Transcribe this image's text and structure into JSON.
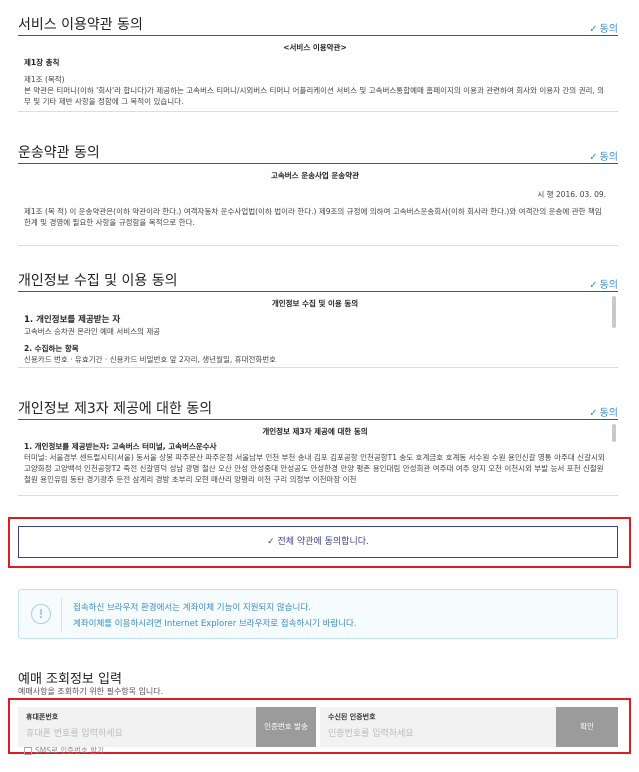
{
  "agree_label": "동의",
  "sections": [
    {
      "title": "서비스 이용약관 동의",
      "doc_title": "<서비스 이용약관>",
      "chapter": "제1장 총칙",
      "article": "제1조 (목적)",
      "body": "본 약관은 티머니(이하 '회사'라 합니다)가 제공하는 고속버스 티머니/시외버스 티머니 어플리케이션 서비스 및 고속버스통합예매 홈페이지의 이용과 관련하여 회사와 이용자 간의 권리, 의무 및 기타 제반 사항을 정함에 그 목적이 있습니다."
    },
    {
      "title": "운송약관 동의",
      "doc_title": "고속버스 운송사업 운송약관",
      "date": "시 행 2016. 03. 09.",
      "body": "제1조 (목 적) 이 운송약관은(이하 약관이라 한다.) 여객자동차 운수사업법(이하 법이라 한다.) 제9조의 규정에 의하여 고속버스운송회사(이하 회사라 한다.)와 여객간의 운송에 관한 책임한계 및 경영에 필요한 사항을 규정함을 목적으로 한다."
    },
    {
      "title": "개인정보 수집 및 이용 동의",
      "doc_title": "개인정보 수집 및 이용 동의",
      "item1": "1. 개인정보를 제공받는 자",
      "item1_desc": "고속버스 승차권 온라인 예매 서비스의 제공",
      "item2": "2. 수집하는 항목",
      "item2_desc": "신용카드 번호 · 유효기간 · 신용카드 비밀번호 앞 2자리, 생년월일, 휴대전화번호"
    },
    {
      "title": "개인정보 제3자 제공에 대한 동의",
      "doc_title": "개인정보 제3자 제공에 대한 동의",
      "item1": "1. 개인정보를 제공받는자: 고속버스 터미널, 고속버스운수사",
      "body": "터미널: 서울경부 센트럴시티(서울) 동서울 상봉 파주문산 파주운정 서울남부 인천 부천 송내 김포 김포공항 인천공항T1 송도 호계금호 호계동 서수원 수원 용인신갈 영통 아주대 신갈시외 고양화정 고양백석 인천공항T2 죽전 신갈영덕 성남 광명 철산 오산 안성 안성중대 안성공도 안성한경 안양 평촌 용인대림 안성회관 여주대 여주 양지 오천 이천시외 부발 능서 포천 신철원 철원 용인유림 동탄 경기광주 둔전 삼계리 경방 초부리 모현 매산리 양평리 이천 구리 의정부 이천마장 이천"
    }
  ],
  "all_agree_label": "✓ 전체 약관에 동의합니다.",
  "notice": {
    "line1": "접속하신 브라우저 환경에서는 계좌이체 기능이 지원되지 않습니다.",
    "line2": "계좌이체를 이용하시려면 Internet Explorer 브라우저로 접속하시기 바랍니다."
  },
  "reservation": {
    "title": "예매 조회정보 입력",
    "subtitle": "예매사항을 조회하기 위한 필수항목 입니다.",
    "phone_label": "휴대폰번호",
    "phone_placeholder": "휴대폰 번호를 입력하세요",
    "send_button": "인증번호 발송",
    "code_label": "수신된 인증번호",
    "code_placeholder": "인증번호를 입력하세요",
    "confirm_button": "확인",
    "sms_label": "SMS로 인증번호 받기"
  },
  "colors": {
    "accent": "#3a8fcc",
    "highlight_frame": "#e01b24",
    "primary_border": "#3f3f8f"
  }
}
